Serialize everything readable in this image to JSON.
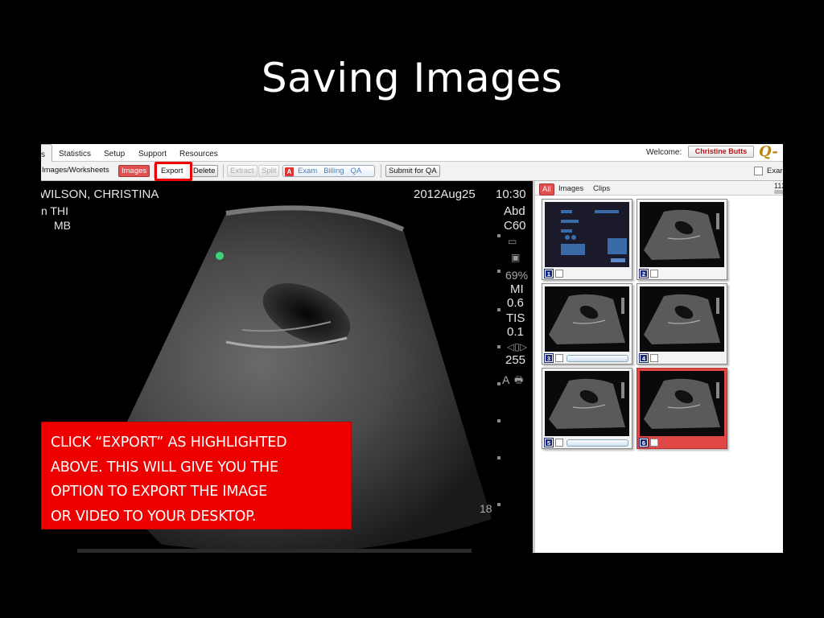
{
  "slide": {
    "title": "Saving Images",
    "callout": {
      "lines": [
        "CLICK “EXPORT” AS HIGHLIGHTED",
        "ABOVE. THIS WILL GIVE YOU THE",
        "OPTION TO EXPORT THE IMAGE",
        "OR VIDEO TO YOUR DESKTOP."
      ],
      "color": "#ee0000"
    }
  },
  "app": {
    "menu": {
      "active_tab": "s",
      "tabs": [
        "Statistics",
        "Setup",
        "Support",
        "Resources"
      ],
      "welcome_label": "Welcome:",
      "user_name": "Christine  Butts",
      "logo_text": "Q-p"
    },
    "toolbar": {
      "images_worksheets": "Images/Worksheets",
      "images": "Images",
      "export": "Export",
      "delete": "Delete",
      "extract": "Extract",
      "split": "Split",
      "pdf_icon": "A",
      "exam": "Exam",
      "billing": "Billing",
      "qa": "QA",
      "submit_for_qa": "Submit for QA",
      "exam_checkbox_label": "Exar",
      "highlight_color": "#e00000"
    },
    "viewer": {
      "patient_name": "WILSON, CHRISTINA",
      "mode_line1": "n  THI",
      "mode_line2": "MB",
      "date": "2012Aug25",
      "time": "10:30",
      "preset": "Abd",
      "probe": "C60",
      "gain": "69%",
      "mi_label": "MI",
      "mi_value": "0.6",
      "tis_label": "TIS",
      "tis_value": "0.1",
      "dynamic_range": "255",
      "depth": "18",
      "a_label": "A",
      "icons": [
        "battery-icon",
        "save-icon",
        "cine-icon",
        "printer-icon"
      ]
    },
    "panel": {
      "tabs": {
        "all": "All",
        "images": "Images",
        "clips": "Clips"
      },
      "counter": "112",
      "thumbnails": [
        {
          "num": "1",
          "kind": "worksheet",
          "selected": false,
          "has_bar": false
        },
        {
          "num": "2",
          "kind": "image",
          "selected": false,
          "has_bar": false
        },
        {
          "num": "3",
          "kind": "clip",
          "selected": false,
          "has_bar": true
        },
        {
          "num": "4",
          "kind": "image",
          "selected": false,
          "has_bar": false
        },
        {
          "num": "5",
          "kind": "clip",
          "selected": false,
          "has_bar": true
        },
        {
          "num": "6",
          "kind": "image",
          "selected": true,
          "has_bar": false
        }
      ],
      "selected_color": "#e04848"
    }
  }
}
